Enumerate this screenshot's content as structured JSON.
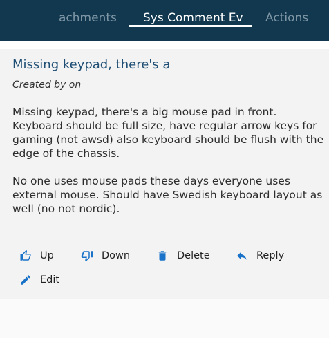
{
  "tabs": {
    "attachments_label": "achments",
    "syscomment_label": "Sys Comment Ev",
    "actions_label": "Actions"
  },
  "comment": {
    "title": "Missing keypad, there's a",
    "meta": "Created by  on",
    "paragraphs": [
      "Missing keypad, there's a big mouse pad in front. Keyboard should be full size, have regular arrow keys for gaming (not awsd) also keyboard should be flush with the edge of the chassis.",
      "No one uses mouse pads these days everyone uses external mouse. Should have Swedish keyboard layout as well (no not nordic)."
    ]
  },
  "actions": {
    "up_label": "Up",
    "down_label": "Down",
    "delete_label": "Delete",
    "reply_label": "Reply",
    "edit_label": "Edit"
  },
  "icons": {
    "up": "thumbs-up-icon",
    "down": "thumbs-down-icon",
    "delete": "trash-icon",
    "reply": "reply-icon",
    "edit": "pencil-icon"
  },
  "colors": {
    "header_bg": "#12384f",
    "active_tab": "#ffffff",
    "inactive_tab": "#7f97a6",
    "title": "#1f4e74",
    "accent": "#1a73c8"
  }
}
